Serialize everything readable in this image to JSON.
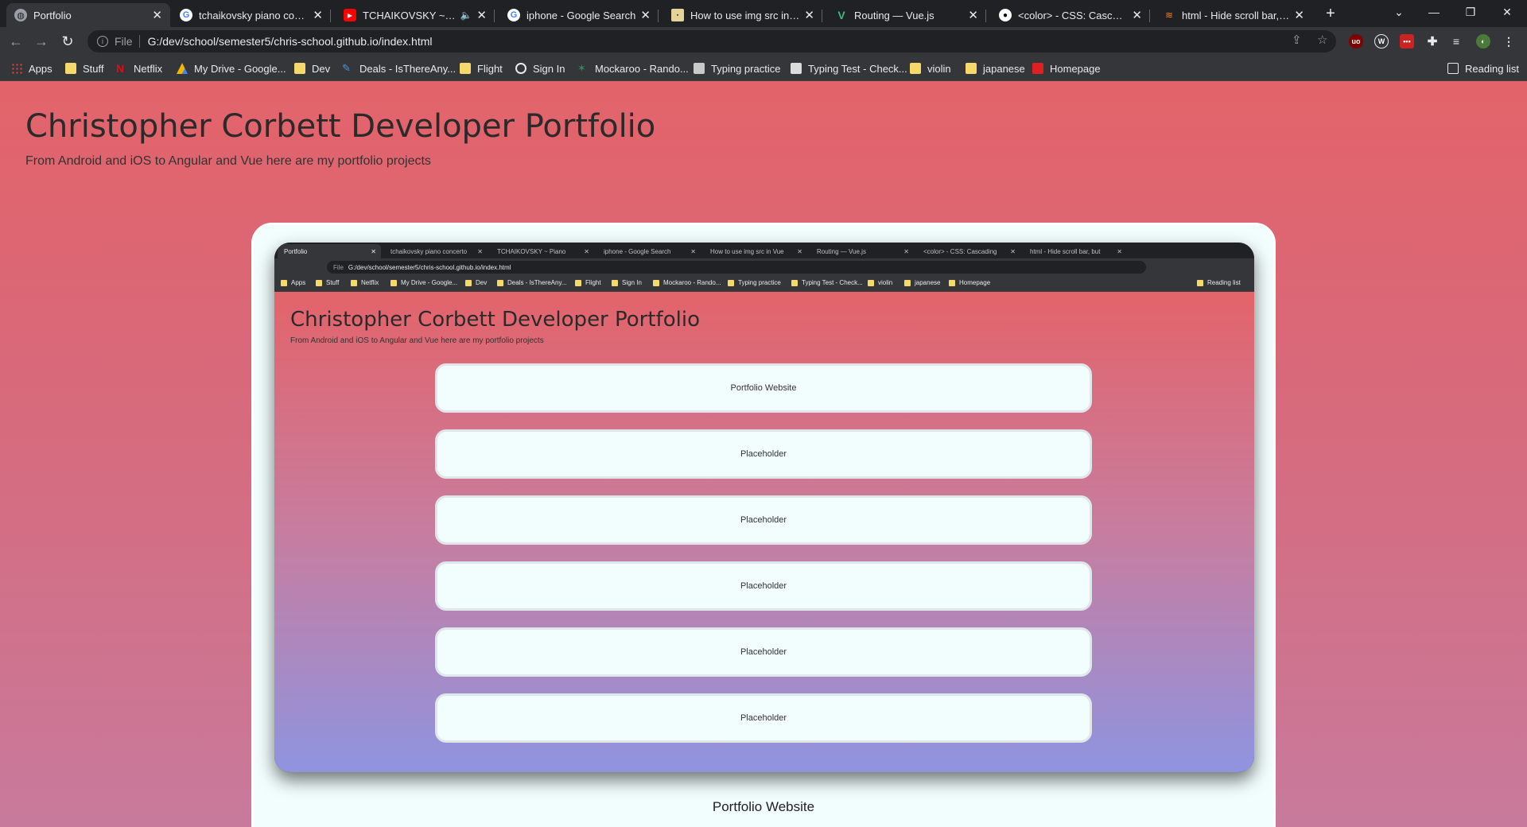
{
  "browser": {
    "tabs": [
      {
        "title": "Portfolio",
        "favicon": "globe-icon",
        "active": true
      },
      {
        "title": "tchaikovsky piano concerto",
        "favicon": "google-icon"
      },
      {
        "title": "TCHAIKOVSKY ~ Piano",
        "favicon": "youtube-icon",
        "audio": true
      },
      {
        "title": "iphone - Google Search",
        "favicon": "google-icon"
      },
      {
        "title": "How to use img src in Vue",
        "favicon": "site-icon"
      },
      {
        "title": "Routing — Vue.js",
        "favicon": "vue-icon"
      },
      {
        "title": "<color> - CSS: Cascading",
        "favicon": "mdn-icon"
      },
      {
        "title": "html - Hide scroll bar, but",
        "favicon": "stackoverflow-icon"
      }
    ],
    "address": {
      "scheme_label": "File",
      "url": "G:/dev/school/semester5/chris-school.github.io/index.html"
    },
    "bookmarks": [
      {
        "label": "Apps",
        "icon": "apps-grid-icon"
      },
      {
        "label": "Stuff",
        "icon": "folder-icon"
      },
      {
        "label": "Netflix",
        "icon": "netflix-icon"
      },
      {
        "label": "My Drive - Google...",
        "icon": "drive-icon"
      },
      {
        "label": "Dev",
        "icon": "folder-icon"
      },
      {
        "label": "Deals - IsThereAny...",
        "icon": "deals-icon"
      },
      {
        "label": "Flight",
        "icon": "folder-icon"
      },
      {
        "label": "Sign In",
        "icon": "globe-icon"
      },
      {
        "label": "Mockaroo - Rando...",
        "icon": "mockaroo-icon"
      },
      {
        "label": "Typing practice",
        "icon": "typing-icon"
      },
      {
        "label": "Typing Test - Check...",
        "icon": "typing-test-icon"
      },
      {
        "label": "violin",
        "icon": "folder-icon"
      },
      {
        "label": "japanese",
        "icon": "folder-icon"
      },
      {
        "label": "Homepage",
        "icon": "homepage-icon"
      }
    ],
    "reading_list": "Reading list"
  },
  "page": {
    "title": "Christopher Corbett Developer Portfolio",
    "subtitle": "From Android and iOS to Angular and Vue here are my portfolio projects",
    "card": {
      "caption": "Portfolio Website",
      "preview": {
        "title": "Christopher Corbett Developer Portfolio",
        "subtitle": "From Android and iOS to Angular and Vue here are my portfolio projects",
        "url": "G:/dev/school/semester5/chris-school.github.io/index.html",
        "scheme_label": "File",
        "buttons": [
          "Portfolio Website",
          "Placeholder",
          "Placeholder",
          "Placeholder",
          "Placeholder",
          "Placeholder"
        ]
      }
    }
  },
  "colors": {
    "page_gradient_top": "#e3636a",
    "page_gradient_bottom": "#c87a9c",
    "card_bg": "#f2fdfd",
    "chrome_dark": "#202124",
    "chrome_toolbar": "#35363a"
  }
}
